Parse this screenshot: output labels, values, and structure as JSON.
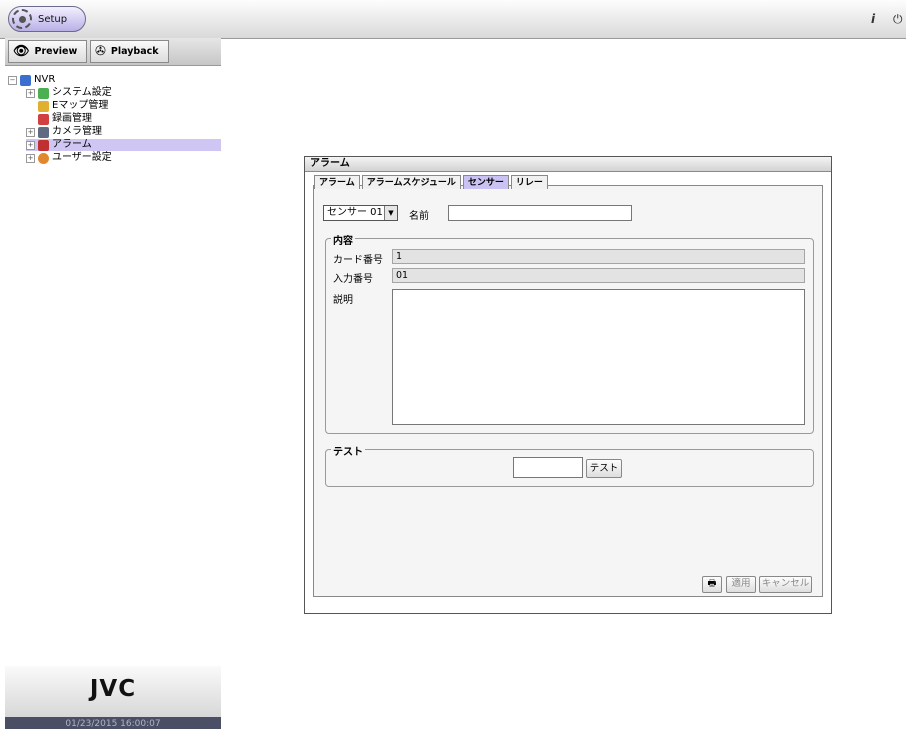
{
  "topbar": {
    "setup_label": "Setup",
    "info_icon": "i",
    "power_icon": "⏻"
  },
  "modes": {
    "preview_label": "Preview",
    "playback_label": "Playback"
  },
  "tree": {
    "root": "NVR",
    "items": [
      {
        "label": "システム設定"
      },
      {
        "label": "Eマップ管理"
      },
      {
        "label": "録画管理"
      },
      {
        "label": "カメラ管理"
      },
      {
        "label": "アラーム"
      },
      {
        "label": "ユーザー設定"
      }
    ]
  },
  "brand": {
    "logo": "JVC",
    "datetime": "01/23/2015 16:00:07"
  },
  "dialog": {
    "title": "アラーム",
    "tabs": [
      "アラーム",
      "アラームスケジュール",
      "センサー",
      "リレー"
    ],
    "sensor_select": "センサー 01",
    "name_label": "名前",
    "name_value": "",
    "content_legend": "内容",
    "card_no_label": "カード番号",
    "card_no_value": "1",
    "input_no_label": "入力番号",
    "input_no_value": "01",
    "desc_label": "説明",
    "desc_value": "",
    "test_legend": "テスト",
    "test_value": "",
    "test_button": "テスト",
    "apply_button": "適用",
    "cancel_button": "キャンセル"
  }
}
